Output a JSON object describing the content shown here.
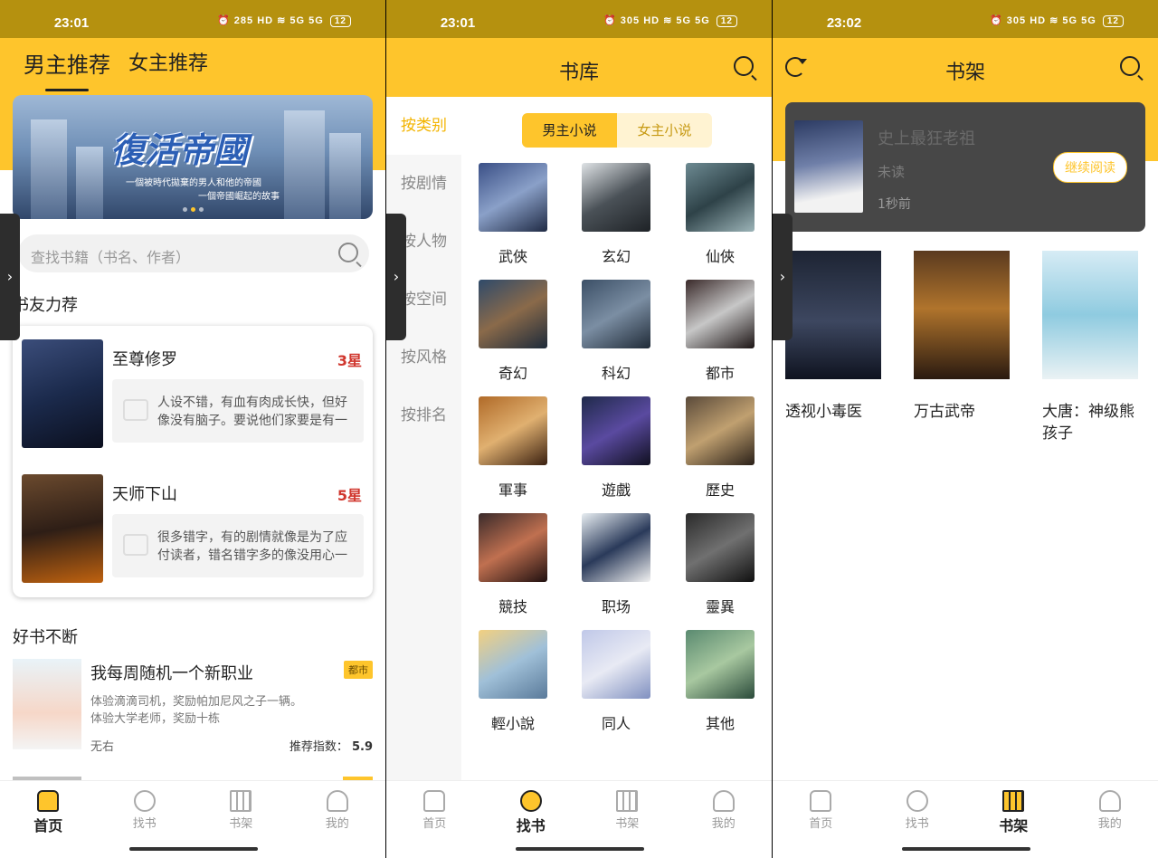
{
  "colors": {
    "accent": "#fec52c",
    "star": "#d0362d",
    "tag": "#fec52c"
  },
  "screens": [
    {
      "status": {
        "time": "23:01",
        "speed": "285",
        "battery": "12"
      },
      "top_tabs": [
        "男主推荐",
        "女主推荐"
      ],
      "banner": {
        "title": "復活帝國",
        "subtitle": "一個被時代拋棄的男人和他的帝國",
        "subtitle2": "一個帝國崛起的故事"
      },
      "search_placeholder": "查找书籍（书名、作者）",
      "section_recommend": "书友力荐",
      "recommendations": [
        {
          "name": "至尊修罗",
          "rating": "3星",
          "review": "人设不错，有血有肉成长快，但好像没有脑子。要说他们家要是有一个聪明的..."
        },
        {
          "name": "天师下山",
          "rating": "5星",
          "review": "很多错字，有的剧情就像是为了应付读者，错名错字多的像没用心一样..."
        }
      ],
      "section_books": "好书不断",
      "books": [
        {
          "name": "我每周随机一个新职业",
          "tag": "都市",
          "desc1": "体验滴滴司机，奖励帕加尼风之子一辆。",
          "desc2": "体验大学老师，奖励十栋",
          "author": "无右",
          "score_label": "推荐指数：",
          "score": "5.9"
        }
      ],
      "tabs": [
        "首页",
        "找书",
        "书架",
        "我的"
      ]
    },
    {
      "status": {
        "time": "23:01",
        "speed": "305",
        "battery": "12"
      },
      "title": "书库",
      "left_menu": [
        "按类别",
        "按剧情",
        "按人物",
        "按空间",
        "按风格",
        "按排名"
      ],
      "segments": [
        "男主小说",
        "女主小说"
      ],
      "categories": [
        "武俠",
        "玄幻",
        "仙俠",
        "奇幻",
        "科幻",
        "都市",
        "軍事",
        "遊戲",
        "歷史",
        "競技",
        "职场",
        "靈異",
        "輕小說",
        "同人",
        "其他"
      ],
      "tabs": [
        "首页",
        "找书",
        "书架",
        "我的"
      ]
    },
    {
      "status": {
        "time": "23:02",
        "speed": "305",
        "battery": "12"
      },
      "title": "书架",
      "recent": {
        "name": "史上最狂老祖",
        "status": "未读",
        "time": "1秒前",
        "action": "继续阅读"
      },
      "shelf": [
        "透视小毒医",
        "万古武帝",
        "大唐：神级熊孩子"
      ],
      "tabs": [
        "首页",
        "找书",
        "书架",
        "我的"
      ]
    }
  ]
}
